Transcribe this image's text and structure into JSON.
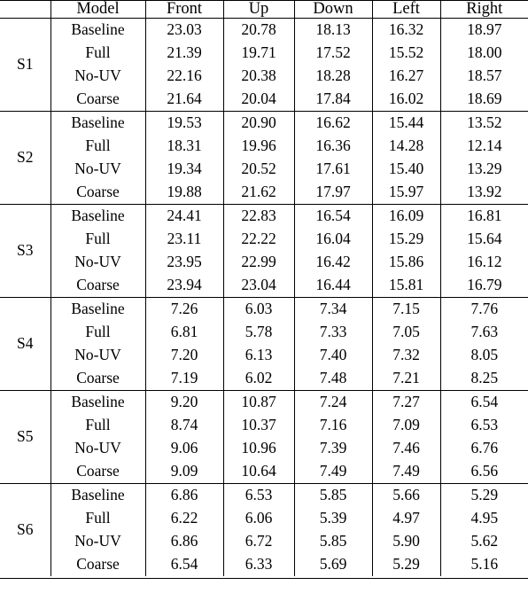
{
  "table": {
    "columns": [
      "",
      "Model",
      "Front",
      "Up",
      "Down",
      "Left",
      "Right"
    ],
    "headers": {
      "group": "",
      "model": "Model",
      "front": "Front",
      "up": "Up",
      "down": "Down",
      "left": "Left",
      "right": "Right"
    },
    "row_labels": [
      "Baseline",
      "Full",
      "No-UV",
      "Coarse"
    ],
    "bold_row_label": "Full",
    "groups": [
      {
        "label": "S1",
        "rows": [
          {
            "model": "Baseline",
            "bold": false,
            "values": [
              "23.03",
              "20.78",
              "18.13",
              "16.32",
              "18.97"
            ]
          },
          {
            "model": "Full",
            "bold": true,
            "values": [
              "21.39",
              "19.71",
              "17.52",
              "15.52",
              "18.00"
            ]
          },
          {
            "model": "No-UV",
            "bold": false,
            "values": [
              "22.16",
              "20.38",
              "18.28",
              "16.27",
              "18.57"
            ]
          },
          {
            "model": "Coarse",
            "bold": false,
            "values": [
              "21.64",
              "20.04",
              "17.84",
              "16.02",
              "18.69"
            ]
          }
        ]
      },
      {
        "label": "S2",
        "rows": [
          {
            "model": "Baseline",
            "bold": false,
            "values": [
              "19.53",
              "20.90",
              "16.62",
              "15.44",
              "13.52"
            ]
          },
          {
            "model": "Full",
            "bold": true,
            "values": [
              "18.31",
              "19.96",
              "16.36",
              "14.28",
              "12.14"
            ]
          },
          {
            "model": "No-UV",
            "bold": false,
            "values": [
              "19.34",
              "20.52",
              "17.61",
              "15.40",
              "13.29"
            ]
          },
          {
            "model": "Coarse",
            "bold": false,
            "values": [
              "19.88",
              "21.62",
              "17.97",
              "15.97",
              "13.92"
            ]
          }
        ]
      },
      {
        "label": "S3",
        "rows": [
          {
            "model": "Baseline",
            "bold": false,
            "values": [
              "24.41",
              "22.83",
              "16.54",
              "16.09",
              "16.81"
            ]
          },
          {
            "model": "Full",
            "bold": true,
            "values": [
              "23.11",
              "22.22",
              "16.04",
              "15.29",
              "15.64"
            ]
          },
          {
            "model": "No-UV",
            "bold": false,
            "values": [
              "23.95",
              "22.99",
              "16.42",
              "15.86",
              "16.12"
            ]
          },
          {
            "model": "Coarse",
            "bold": false,
            "values": [
              "23.94",
              "23.04",
              "16.44",
              "15.81",
              "16.79"
            ]
          }
        ]
      },
      {
        "label": "S4",
        "rows": [
          {
            "model": "Baseline",
            "bold": false,
            "values": [
              "7.26",
              "6.03",
              "7.34",
              "7.15",
              "7.76"
            ]
          },
          {
            "model": "Full",
            "bold": true,
            "values": [
              "6.81",
              "5.78",
              "7.33",
              "7.05",
              "7.63"
            ]
          },
          {
            "model": "No-UV",
            "bold": false,
            "values": [
              "7.20",
              "6.13",
              "7.40",
              "7.32",
              "8.05"
            ]
          },
          {
            "model": "Coarse",
            "bold": false,
            "values": [
              "7.19",
              "6.02",
              "7.48",
              "7.21",
              "8.25"
            ]
          }
        ]
      },
      {
        "label": "S5",
        "rows": [
          {
            "model": "Baseline",
            "bold": false,
            "values": [
              "9.20",
              "10.87",
              "7.24",
              "7.27",
              "6.54"
            ]
          },
          {
            "model": "Full",
            "bold": true,
            "values": [
              "8.74",
              "10.37",
              "7.16",
              "7.09",
              "6.53"
            ]
          },
          {
            "model": "No-UV",
            "bold": false,
            "values": [
              "9.06",
              "10.96",
              "7.39",
              "7.46",
              "6.76"
            ]
          },
          {
            "model": "Coarse",
            "bold": false,
            "values": [
              "9.09",
              "10.64",
              "7.49",
              "7.49",
              "6.56"
            ]
          }
        ]
      },
      {
        "label": "S6",
        "rows": [
          {
            "model": "Baseline",
            "bold": false,
            "values": [
              "6.86",
              "6.53",
              "5.85",
              "5.66",
              "5.29"
            ]
          },
          {
            "model": "Full",
            "bold": true,
            "values": [
              "6.22",
              "6.06",
              "5.39",
              "4.97",
              "4.95"
            ]
          },
          {
            "model": "No-UV",
            "bold": false,
            "values": [
              "6.86",
              "6.72",
              "5.85",
              "5.90",
              "5.62"
            ]
          },
          {
            "model": "Coarse",
            "bold": false,
            "values": [
              "6.54",
              "6.33",
              "5.69",
              "5.29",
              "5.16"
            ]
          }
        ]
      }
    ]
  }
}
